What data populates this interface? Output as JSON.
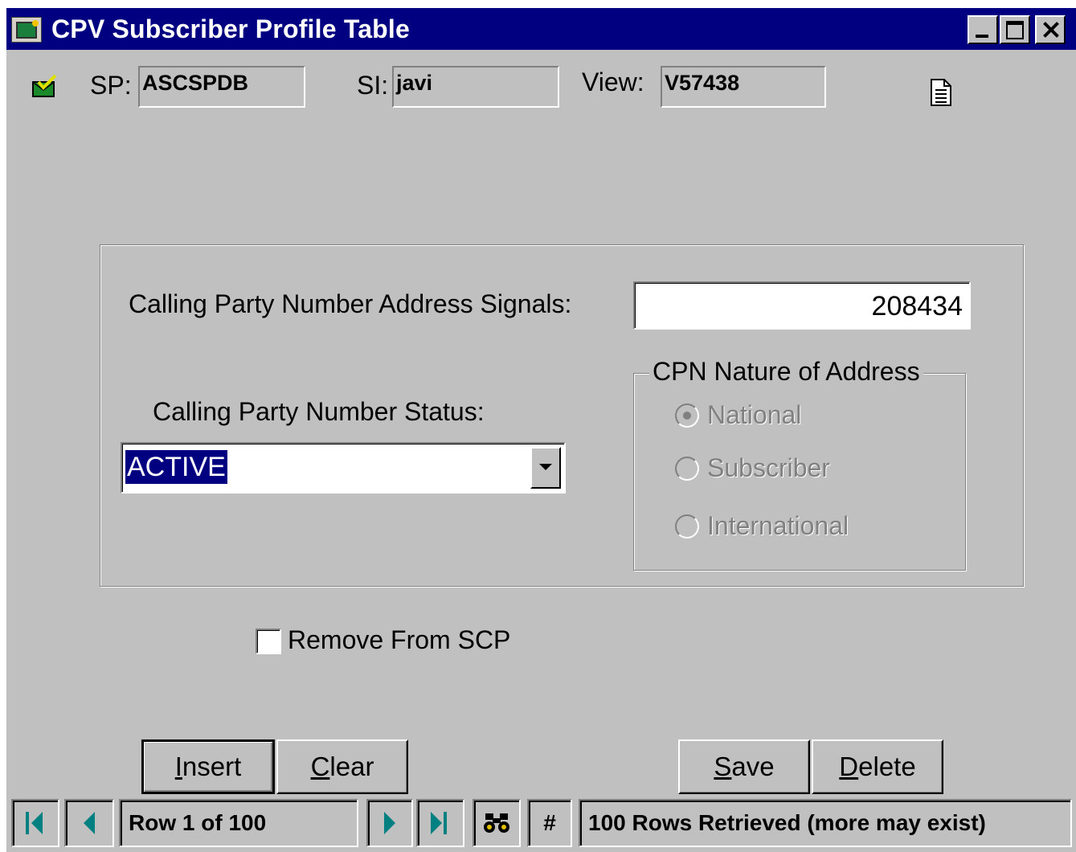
{
  "window": {
    "title": "CPV Subscriber Profile Table",
    "colors": {
      "titlebar": "#000080",
      "face": "#c0c0c0",
      "selection": "#000080",
      "nav_icon": "#008080"
    }
  },
  "header": {
    "sp_label": "SP:",
    "sp_value": "ASCSPDB",
    "si_label": "SI:",
    "si_value": "javi",
    "view_label": "View:",
    "view_value": "V57438",
    "status_icon": "check-envelope-icon",
    "doc_icon": "document-icon"
  },
  "form": {
    "address_label": "Calling Party Number Address Signals:",
    "address_value": "208434",
    "status_label": "Calling Party Number Status:",
    "status_value": "ACTIVE",
    "nature_group_label": "CPN Nature of Address",
    "nature_options": [
      "National",
      "Subscriber",
      "International"
    ],
    "nature_selected": "National",
    "remove_label": "Remove From SCP",
    "remove_checked": false
  },
  "buttons": {
    "insert_label": "Insert",
    "clear_label": "Clear",
    "save_label": "Save",
    "delete_label": "Delete"
  },
  "statusbar": {
    "row_text": "Row 1 of 100",
    "hash": "#",
    "message": "100 Rows Retrieved (more may exist)"
  }
}
